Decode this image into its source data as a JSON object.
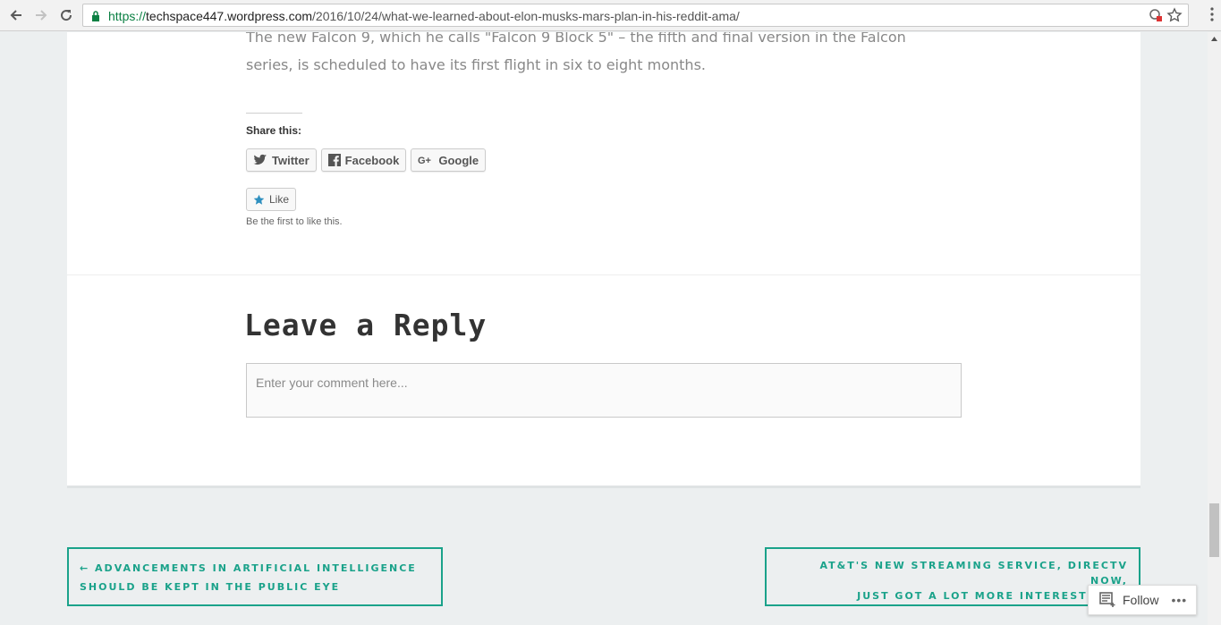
{
  "browser": {
    "url_scheme": "https://",
    "url_host": "techspace447.wordpress.com",
    "url_path": "/2016/10/24/what-we-learned-about-elon-musks-mars-plan-in-his-reddit-ama/"
  },
  "article": {
    "paragraph_line1": "The new Falcon 9, which he calls \"Falcon 9 Block 5\" – the fifth and final version in the Falcon",
    "paragraph_line2": "series, is scheduled to have its first flight in six to eight months."
  },
  "share": {
    "title": "Share this:",
    "buttons": [
      {
        "label": "Twitter",
        "icon": "twitter-icon"
      },
      {
        "label": "Facebook",
        "icon": "facebook-icon"
      },
      {
        "label": "Google",
        "icon": "google-plus-icon"
      }
    ]
  },
  "like": {
    "label": "Like",
    "note": "Be the first to like this."
  },
  "reply": {
    "title": "Leave a Reply",
    "placeholder": "Enter your comment here..."
  },
  "post_nav": {
    "prev_line1": "Advancements in Artificial Intelligence",
    "prev_line2": "Should be Kept in the Public Eye",
    "next_line1": "AT&T's New Streaming Service, DirecTV Now,",
    "next_line2": "Just Got a Lot More Interesting"
  },
  "follow": {
    "label": "Follow",
    "more": "•••"
  },
  "colors": {
    "accent": "#1aa28a",
    "page_bg": "#eceff0"
  }
}
